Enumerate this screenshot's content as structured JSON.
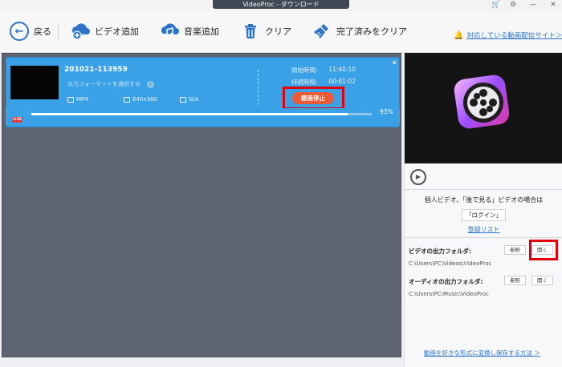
{
  "window": {
    "title": "VideoProc - ダウンロード"
  },
  "toolbar": {
    "back_label": "戻る",
    "add_video_label": "ビデオ追加",
    "add_music_label": "音楽追加",
    "clear_label": "クリア",
    "clear_done_label": "完了済みをクリア",
    "supported_sites_label": "対応している動画配信サイト＞"
  },
  "task": {
    "filename": "201021-113959",
    "format_hint": "出力フォーマットを選択する",
    "format": "MP4",
    "resolution": "640x360",
    "size": "N/A",
    "start_time_label": "開始時間:",
    "start_time_value": "11:40:10",
    "duration_label": "持続時間:",
    "duration_value": "00:01:02",
    "stop_button": "録画停止",
    "live_badge": "LIVE",
    "progress_text": "93%",
    "progress": 0.93
  },
  "side": {
    "login_text": "個人ビデオ、「後で見る」ビデオの場合は",
    "login_button": "「ログイン」",
    "register_link": "登録リスト",
    "video_folder_label": "ビデオの出力フォルダ:",
    "video_folder_path": "C:\\Users\\PC\\Videos\\VideoProc",
    "audio_folder_label": "オーディオの出力フォルダ:",
    "audio_folder_path": "C:\\Users\\PC\\Music\\VideoProc",
    "browse_label": "参照",
    "open_label": "開く",
    "footer_link": "動画を好きな形式に変換し保存する方法 ＞"
  },
  "colors": {
    "accent": "#2b74c7",
    "card": "#3aa1e6",
    "stop": "#ea5a34",
    "highlight": "#e0000c"
  }
}
